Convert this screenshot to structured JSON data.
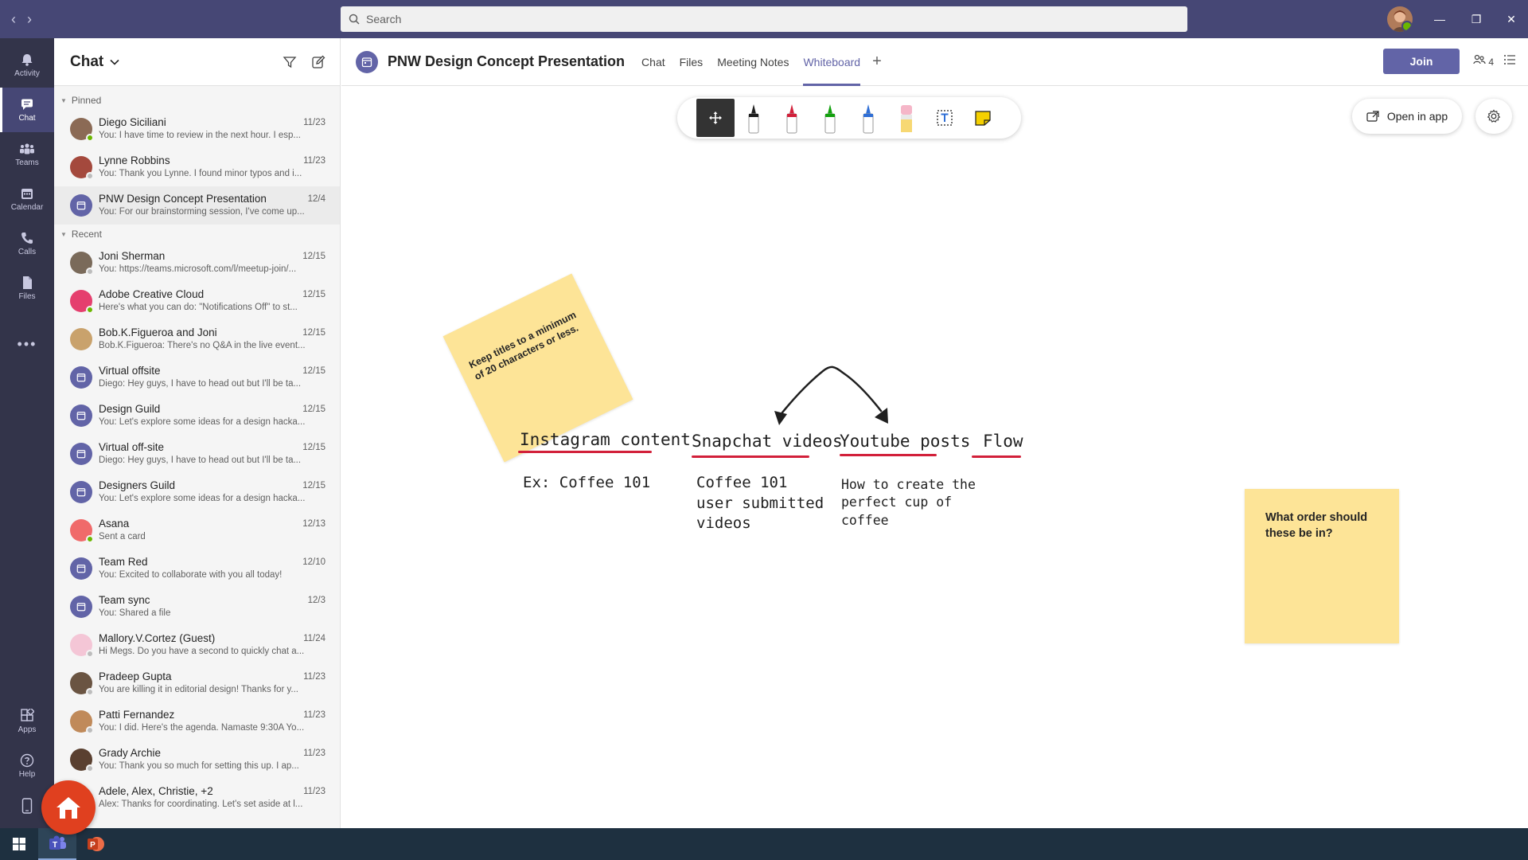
{
  "titlebar": {
    "search_placeholder": "Search"
  },
  "rail": {
    "items": [
      {
        "label": "Activity",
        "icon": "bell-icon"
      },
      {
        "label": "Chat",
        "icon": "chat-icon"
      },
      {
        "label": "Teams",
        "icon": "teams-icon"
      },
      {
        "label": "Calendar",
        "icon": "calendar-icon"
      },
      {
        "label": "Calls",
        "icon": "phone-icon"
      },
      {
        "label": "Files",
        "icon": "file-icon"
      }
    ],
    "bottom": [
      {
        "label": "Apps",
        "icon": "apps-icon"
      },
      {
        "label": "Help",
        "icon": "help-icon"
      }
    ]
  },
  "chat_panel": {
    "title": "Chat",
    "pinned_label": "Pinned",
    "recent_label": "Recent",
    "pinned": [
      {
        "name": "Diego Siciliani",
        "date": "11/23",
        "preview": "You: I have time to review in the next hour. I esp...",
        "avatar_color": "#8b6a55",
        "status": "#6bb700"
      },
      {
        "name": "Lynne Robbins",
        "date": "11/23",
        "preview": "You: Thank you Lynne. I found minor typos and i...",
        "avatar_color": "#a4493d",
        "status": "#bdbdbd"
      },
      {
        "name": "PNW Design Concept Presentation",
        "date": "12/4",
        "preview": "You: For our brainstorming session, I've come up...",
        "avatar_color": "#6264a7",
        "status": ""
      }
    ],
    "recent": [
      {
        "name": "Joni Sherman",
        "date": "12/15",
        "preview": "You: https://teams.microsoft.com/l/meetup-join/...",
        "avatar_color": "#7a6a5a",
        "status": "#bdbdbd"
      },
      {
        "name": "Adobe Creative Cloud",
        "date": "12/15",
        "preview": "Here's what you can do: \"Notifications Off\" to st...",
        "avatar_color": "#e53f6e",
        "status": "#6bb700"
      },
      {
        "name": "Bob.K.Figueroa and Joni",
        "date": "12/15",
        "preview": "Bob.K.Figueroa: There's no Q&A in the live event...",
        "avatar_color": "#c9a26c",
        "status": ""
      },
      {
        "name": "Virtual offsite",
        "date": "12/15",
        "preview": "Diego: Hey guys, I have to head out but I'll be ta...",
        "avatar_color": "#6264a7",
        "status": ""
      },
      {
        "name": "Design Guild",
        "date": "12/15",
        "preview": "You: Let's explore some ideas for a design hacka...",
        "avatar_color": "#6264a7",
        "status": ""
      },
      {
        "name": "Virtual off-site",
        "date": "12/15",
        "preview": "Diego: Hey guys, I have to head out but I'll be ta...",
        "avatar_color": "#6264a7",
        "status": ""
      },
      {
        "name": "Designers Guild",
        "date": "12/15",
        "preview": "You: Let's explore some ideas for a design hacka...",
        "avatar_color": "#6264a7",
        "status": ""
      },
      {
        "name": "Asana",
        "date": "12/13",
        "preview": "Sent a card",
        "avatar_color": "#f06a6a",
        "status": "#6bb700"
      },
      {
        "name": "Team Red",
        "date": "12/10",
        "preview": "You: Excited to collaborate with you all today!",
        "avatar_color": "#6264a7",
        "status": ""
      },
      {
        "name": "Team sync",
        "date": "12/3",
        "preview": "You: Shared a file",
        "avatar_color": "#6264a7",
        "status": ""
      },
      {
        "name": "Mallory.V.Cortez (Guest)",
        "date": "11/24",
        "preview": "Hi Megs. Do you have a second to quickly chat a...",
        "avatar_color": "#f4c6d6",
        "status": "#bdbdbd"
      },
      {
        "name": "Pradeep Gupta",
        "date": "11/23",
        "preview": "You are killing it in editorial design! Thanks for y...",
        "avatar_color": "#6a5442",
        "status": "#bdbdbd"
      },
      {
        "name": "Patti Fernandez",
        "date": "11/23",
        "preview": "You: I did. Here's the agenda. Namaste 9:30A Yo...",
        "avatar_color": "#c08a5a",
        "status": "#bdbdbd"
      },
      {
        "name": "Grady Archie",
        "date": "11/23",
        "preview": "You: Thank you so much for setting this up. I ap...",
        "avatar_color": "#5a4030",
        "status": "#bdbdbd"
      },
      {
        "name": "Adele, Alex, Christie, +2",
        "date": "11/23",
        "preview": "Alex: Thanks for coordinating. Let's set aside at l...",
        "avatar_color": "#6264a7",
        "status": ""
      }
    ]
  },
  "main": {
    "title": "PNW Design Concept Presentation",
    "tabs": [
      "Chat",
      "Files",
      "Meeting Notes",
      "Whiteboard"
    ],
    "active_tab": "Whiteboard",
    "join_label": "Join",
    "participants_count": "4"
  },
  "whiteboard": {
    "open_in_app": "Open in app",
    "sticky_left": "Keep titles to a minimum of 20 characters or less.",
    "sticky_right": "What order should these be in?",
    "headings": [
      "Instagram content",
      "Snapchat videos",
      "Youtube posts",
      "Flow"
    ],
    "notes": [
      "Ex: Coffee 101",
      "Coffee 101 user submitted videos",
      "How to create the perfect cup of coffee"
    ],
    "pens": [
      "#1f1f1f",
      "#d2203a",
      "#13a10e",
      "#2f6fd6"
    ],
    "underline_color": "#d2203a"
  }
}
